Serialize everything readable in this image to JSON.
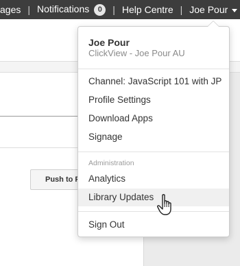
{
  "topbar": {
    "messages_label": "ages",
    "notifications_label": "Notifications",
    "notifications_count": "0",
    "help_label": "Help Centre",
    "user_label": "Joe Pour"
  },
  "page": {
    "push_button_label": "Push to F"
  },
  "dropdown": {
    "user_name": "Joe Pour",
    "user_subtitle": "ClickView - Joe Pour AU",
    "items": [
      {
        "label": "Channel: JavaScript 101 with JP"
      },
      {
        "label": "Profile Settings"
      },
      {
        "label": "Download Apps"
      },
      {
        "label": "Signage"
      }
    ],
    "admin_section_label": "Administration",
    "admin_items": [
      {
        "label": "Analytics"
      },
      {
        "label": "Library Updates"
      }
    ],
    "sign_out_label": "Sign Out"
  },
  "colors": {
    "topbar_bg": "#3d3d3d",
    "hover_bg": "#f0f0f0"
  },
  "icons": {
    "cursor": "hand-pointer-icon",
    "user_menu_caret": "caret-down-icon"
  }
}
